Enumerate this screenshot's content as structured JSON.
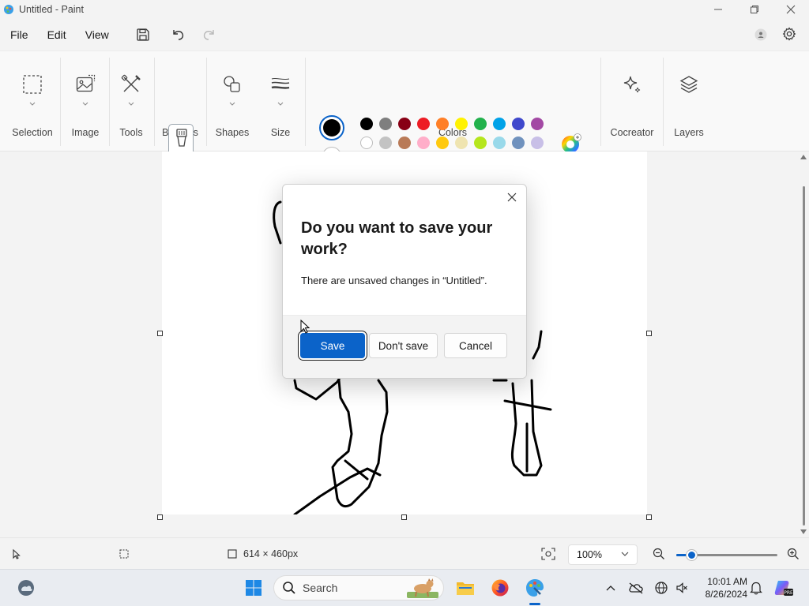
{
  "window": {
    "title": "Untitled - Paint",
    "controls": {
      "minimize": "minimize-icon",
      "maximize": "restore-icon",
      "close": "close-icon"
    }
  },
  "menu": {
    "items": [
      "File",
      "Edit",
      "View"
    ],
    "quick_actions": [
      "save-icon",
      "undo-icon",
      "redo-icon"
    ]
  },
  "ribbon": {
    "groups": {
      "selection": "Selection",
      "image": "Image",
      "tools": "Tools",
      "brushes": "Brushes",
      "shapes": "Shapes",
      "size": "Size",
      "colors": "Colors",
      "cocreator": "Cocreator",
      "layers": "Layers"
    },
    "current_colors": {
      "primary": "#000000",
      "secondary": "#ffffff"
    },
    "palette": [
      [
        "#000000",
        "#7f7f7f",
        "#880015",
        "#ed1c24",
        "#ff7f27",
        "#fff200",
        "#22b14c",
        "#00a2e8",
        "#3f48cc",
        "#a349a4"
      ],
      [
        "#ffffff",
        "#c3c3c3",
        "#b97a57",
        "#ffaec9",
        "#ffc90e",
        "#efe4b0",
        "#b5e61d",
        "#99d9ea",
        "#7092be",
        "#c8bfe7"
      ],
      [
        "",
        "",
        "",
        "",
        "",
        "",
        "",
        "",
        "",
        ""
      ]
    ]
  },
  "dialog": {
    "title": "Do you want to save your work?",
    "message": "There are unsaved changes in “Untitled”.",
    "buttons": {
      "save": "Save",
      "dont_save": "Don't save",
      "cancel": "Cancel"
    }
  },
  "status": {
    "canvas_size": "614 × 460px",
    "zoom": "100%",
    "zoom_slider_value": 0.15
  },
  "taskbar": {
    "search_label": "Search",
    "time": "10:01 AM",
    "date": "8/26/2024"
  },
  "colors": {
    "accent": "#0b63c9"
  }
}
